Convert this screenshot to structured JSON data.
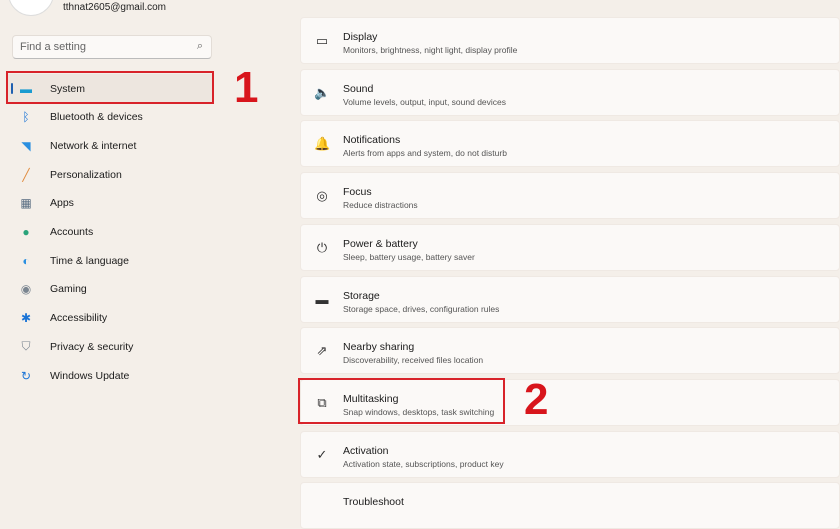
{
  "account": {
    "email": "tthnat2605@gmail.com"
  },
  "search": {
    "placeholder": "Find a setting",
    "icon": "search-icon"
  },
  "nav": [
    {
      "label": "System",
      "icon": "system-icon",
      "color": "#1a9bd0"
    },
    {
      "label": "Bluetooth & devices",
      "icon": "bluetooth-icon",
      "color": "#1b74d6"
    },
    {
      "label": "Network & internet",
      "icon": "wifi-icon",
      "color": "#2a8fe0"
    },
    {
      "label": "Personalization",
      "icon": "brush-icon",
      "color": "#e08a3c"
    },
    {
      "label": "Apps",
      "icon": "apps-icon",
      "color": "#566b80"
    },
    {
      "label": "Accounts",
      "icon": "accounts-icon",
      "color": "#2aa37a"
    },
    {
      "label": "Time & language",
      "icon": "globe-icon",
      "color": "#2a8fe0"
    },
    {
      "label": "Gaming",
      "icon": "gamepad-icon",
      "color": "#7a8590"
    },
    {
      "label": "Accessibility",
      "icon": "accessibility-icon",
      "color": "#1b74d6"
    },
    {
      "label": "Privacy & security",
      "icon": "shield-icon",
      "color": "#7a8590"
    },
    {
      "label": "Windows Update",
      "icon": "update-icon",
      "color": "#1b74d6"
    }
  ],
  "cards": [
    {
      "title": "Display",
      "subtitle": "Monitors, brightness, night light, display profile",
      "icon": "monitor-icon",
      "glyph": "▭"
    },
    {
      "title": "Sound",
      "subtitle": "Volume levels, output, input, sound devices",
      "icon": "speaker-icon",
      "glyph": "🔈"
    },
    {
      "title": "Notifications",
      "subtitle": "Alerts from apps and system, do not disturb",
      "icon": "bell-icon",
      "glyph": "🔔"
    },
    {
      "title": "Focus",
      "subtitle": "Reduce distractions",
      "icon": "focus-icon",
      "glyph": "◎"
    },
    {
      "title": "Power & battery",
      "subtitle": "Sleep, battery usage, battery saver",
      "icon": "power-icon",
      "glyph": "⏻"
    },
    {
      "title": "Storage",
      "subtitle": "Storage space, drives, configuration rules",
      "icon": "storage-icon",
      "glyph": "▬"
    },
    {
      "title": "Nearby sharing",
      "subtitle": "Discoverability, received files location",
      "icon": "share-icon",
      "glyph": "⇗"
    },
    {
      "title": "Multitasking",
      "subtitle": "Snap windows, desktops, task switching",
      "icon": "multitasking-icon",
      "glyph": "⧉"
    },
    {
      "title": "Activation",
      "subtitle": "Activation state, subscriptions, product key",
      "icon": "check-circle-icon",
      "glyph": "✓"
    },
    {
      "title": "Troubleshoot",
      "subtitle": "",
      "icon": "wrench-icon",
      "glyph": ""
    }
  ],
  "annotations": {
    "step1": "1",
    "step2": "2",
    "color": "#d8232a"
  }
}
